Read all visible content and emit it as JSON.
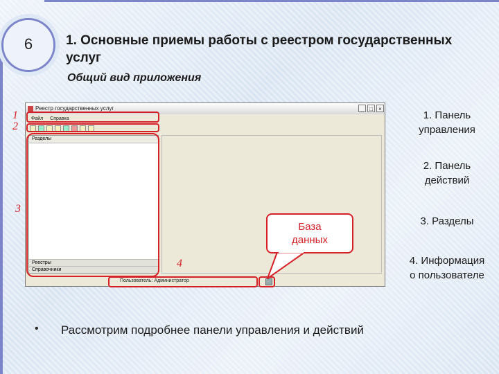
{
  "slide": {
    "number": "6",
    "title": "1. Основные приемы работы с реестром государственных услуг",
    "subtitle": "Общий вид приложения",
    "bullet": "Рассмотрим подробнее панели управления и действий"
  },
  "app": {
    "window_title": "Реестр государственных услуг",
    "window_controls": [
      "_",
      "□",
      "×"
    ],
    "menu": [
      "Файл",
      "Справка"
    ],
    "left_panel_header": "Разделы",
    "left_panel_tabs": [
      "Реестры",
      "Справочники"
    ],
    "status_text": "Пользователь: Администратор"
  },
  "markers": [
    "1",
    "2",
    "3",
    "4"
  ],
  "callout": {
    "label_line1": "База",
    "label_line2": "данных"
  },
  "legend": [
    {
      "line1": "1. Панель",
      "line2": "управления"
    },
    {
      "line1": "2. Панель",
      "line2": "действий"
    },
    {
      "line1": "3. Разделы",
      "line2": ""
    },
    {
      "line1": "4. Информация",
      "line2": "о пользователе"
    }
  ],
  "colors": {
    "highlight": "#d62027",
    "band": "#7c85c9"
  }
}
